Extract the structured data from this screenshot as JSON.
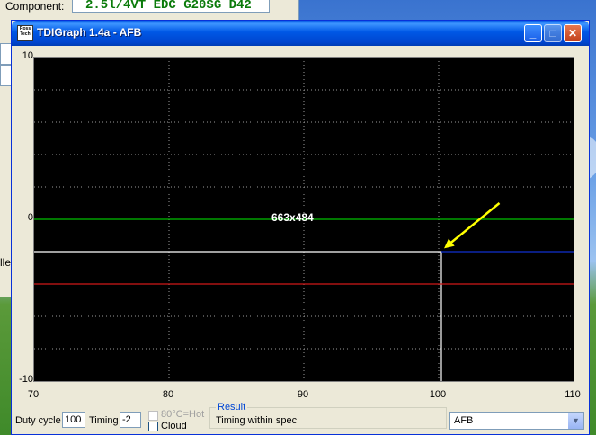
{
  "background_window": {
    "component_label": "Component:",
    "component_value": "2.5l/4VT EDC G20SG  D42",
    "partial_text": "lle"
  },
  "window": {
    "title": "TDIGraph 1.4a - AFB",
    "icon_text": "Ross Tech",
    "buttons": {
      "minimize": "_",
      "maximize": "□",
      "close": "✕"
    }
  },
  "chart_data": {
    "type": "line",
    "xlim": [
      70,
      110
    ],
    "ylim": [
      -10,
      10
    ],
    "x_ticks": [
      "70",
      "80",
      "90",
      "100",
      "110"
    ],
    "y_ticks": [
      "10",
      "0",
      "-10"
    ],
    "grid": true,
    "watermark": "663x484",
    "series": [
      {
        "color": "#00c000",
        "points": [
          [
            70,
            0
          ],
          [
            110,
            0
          ]
        ]
      },
      {
        "color": "#ffffff",
        "points": [
          [
            70,
            -2
          ],
          [
            100.2,
            -2
          ],
          [
            100.2,
            -10
          ]
        ]
      },
      {
        "color": "#1030d0",
        "points": [
          [
            100.2,
            -2
          ],
          [
            110,
            -2
          ]
        ]
      },
      {
        "color": "#d01818",
        "points": [
          [
            70,
            -4
          ],
          [
            110,
            -4
          ]
        ]
      }
    ],
    "annotation": {
      "type": "arrow",
      "color": "#ffff00",
      "target": [
        100.4,
        -1.8
      ],
      "from": [
        104.5,
        1
      ]
    }
  },
  "status": {
    "duty_cycle_label": "Duty cycle",
    "duty_cycle_value": "100",
    "timing_label": "Timing",
    "timing_value": "-2",
    "hot_label": "80°C=Hot",
    "cloud_label": "Cloud",
    "result_legend": "Result",
    "result_value": "Timing within spec",
    "dropdown_value": "AFB"
  }
}
